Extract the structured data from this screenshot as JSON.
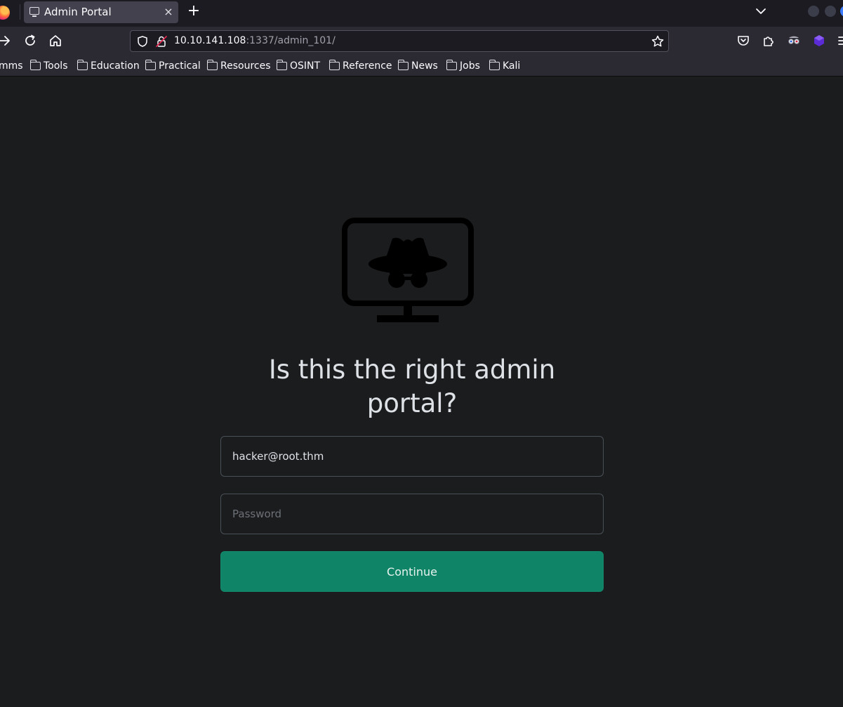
{
  "browser": {
    "tab": {
      "title": "Admin Portal",
      "close_glyph": "×"
    },
    "new_tab_glyph": "+",
    "url": {
      "host": "10.10.141.108",
      "path": ":1337/admin_101/"
    },
    "bookmarks": [
      "mms",
      "Tools",
      "Education",
      "Practical",
      "Resources",
      "OSINT",
      "Reference",
      "News",
      "Jobs",
      "Kali"
    ],
    "icons": {
      "tabstrip": [
        "firefox-logo-icon",
        "monitor-icon",
        "close-icon",
        "plus-icon",
        "chevron-down-icon"
      ],
      "toolbar": [
        "forward-icon",
        "reload-icon",
        "home-icon",
        "shield-icon",
        "lock-icon",
        "star-icon",
        "pocket-icon",
        "extensions-icon",
        "extension-glasses-icon",
        "extension-cube-icon",
        "menu-icon"
      ],
      "bookmark": "folder-icon"
    }
  },
  "page": {
    "heading": "Is this the right admin portal?",
    "email_value": "hacker@root.thm",
    "password_placeholder": "Password",
    "continue_label": "Continue",
    "icon": "spy-monitor-icon"
  },
  "colors": {
    "page_bg": "#1b1c1e",
    "button_bg": "#0f8466",
    "toolbar_bg": "#2b2a33",
    "tabstrip_bg": "#1c1b22"
  }
}
